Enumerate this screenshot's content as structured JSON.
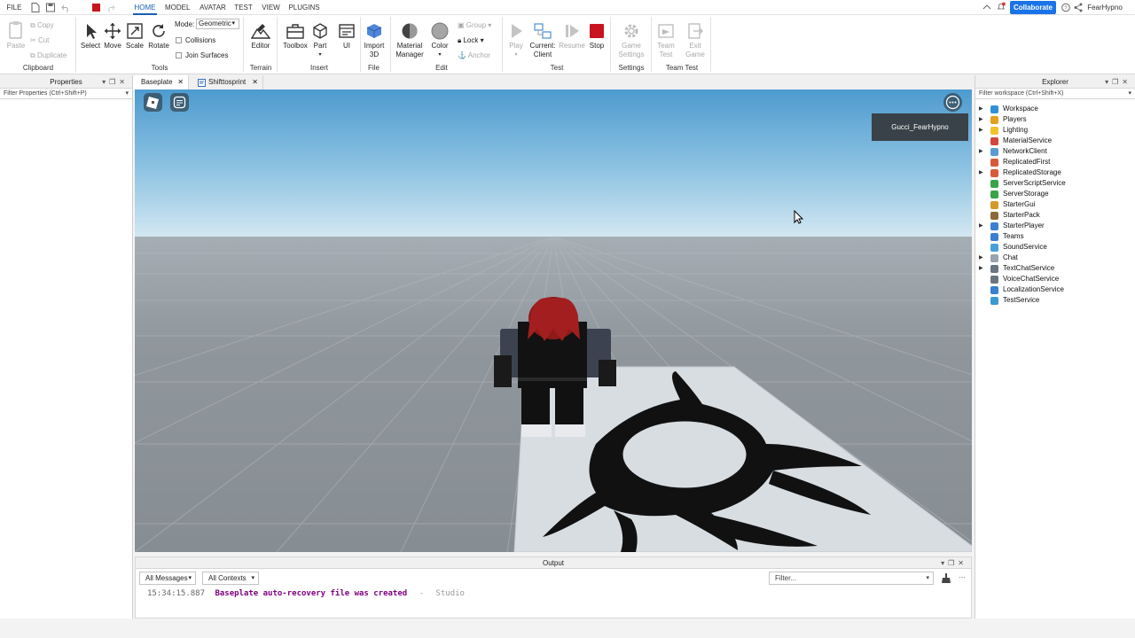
{
  "menubar": {
    "file": "FILE",
    "tabs": [
      "HOME",
      "MODEL",
      "AVATAR",
      "TEST",
      "VIEW",
      "PLUGINS"
    ],
    "collaborate": "Collaborate",
    "username": "FearHypno"
  },
  "ribbon": {
    "clipboard": {
      "paste": "Paste",
      "copy": "Copy",
      "cut": "Cut",
      "duplicate": "Duplicate",
      "group": "Clipboard"
    },
    "tools": {
      "select": "Select",
      "move": "Move",
      "scale": "Scale",
      "rotate": "Rotate",
      "mode_label": "Mode:",
      "mode_value": "Geometric",
      "collisions": "Collisions",
      "join_surfaces": "Join Surfaces",
      "group": "Tools"
    },
    "terrain": {
      "editor": "Editor",
      "group": "Terrain"
    },
    "insert": {
      "toolbox": "Toolbox",
      "part": "Part",
      "ui": "UI",
      "group": "Insert"
    },
    "file": {
      "import_line1": "Import",
      "import_line2": "3D",
      "group": "File"
    },
    "edit": {
      "material_line1": "Material",
      "material_line2": "Manager",
      "color": "Color",
      "group_btn": "Group",
      "lock": "Lock",
      "anchor": "Anchor",
      "group": "Edit"
    },
    "test": {
      "play": "Play",
      "current_line1": "Current:",
      "current_line2": "Client",
      "resume": "Resume",
      "stop": "Stop",
      "group": "Test"
    },
    "settings": {
      "game_line1": "Game",
      "game_line2": "Settings",
      "group": "Settings"
    },
    "teamtest": {
      "team_line1": "Team",
      "team_line2": "Test",
      "exit_line1": "Exit",
      "exit_line2": "Game",
      "group": "Team Test"
    }
  },
  "properties": {
    "title": "Properties",
    "filter": "Filter Properties (Ctrl+Shift+P)"
  },
  "doc_tabs": [
    "Baseplate",
    "Shifttosprint"
  ],
  "viewport": {
    "player_tag": "Gucci_FearHypno"
  },
  "output": {
    "title": "Output",
    "messages_filter": "All Messages",
    "contexts_filter": "All Contexts",
    "filter_placeholder": "Filter...",
    "log": {
      "time": "15:34:15.887",
      "message": "Baseplate auto-recovery file was created",
      "separator": "-",
      "source": "Studio"
    }
  },
  "explorer": {
    "title": "Explorer",
    "filter": "Filter workspace (Ctrl+Shift+X)",
    "items": [
      {
        "name": "Workspace",
        "expandable": true,
        "icon_color": "#2f8fd6"
      },
      {
        "name": "Players",
        "expandable": true,
        "icon_color": "#e0a020"
      },
      {
        "name": "Lighting",
        "expandable": true,
        "icon_color": "#f2c12e"
      },
      {
        "name": "MaterialService",
        "expandable": false,
        "icon_color": "#d0463a"
      },
      {
        "name": "NetworkClient",
        "expandable": true,
        "icon_color": "#5b9bd5"
      },
      {
        "name": "ReplicatedFirst",
        "expandable": false,
        "icon_color": "#d75a3a"
      },
      {
        "name": "ReplicatedStorage",
        "expandable": true,
        "icon_color": "#d75a3a"
      },
      {
        "name": "ServerScriptService",
        "expandable": false,
        "icon_color": "#3aa34a"
      },
      {
        "name": "ServerStorage",
        "expandable": false,
        "icon_color": "#3aa34a"
      },
      {
        "name": "StarterGui",
        "expandable": false,
        "icon_color": "#d39a2a"
      },
      {
        "name": "StarterPack",
        "expandable": false,
        "icon_color": "#8b6a3a"
      },
      {
        "name": "StarterPlayer",
        "expandable": true,
        "icon_color": "#3a7fd0"
      },
      {
        "name": "Teams",
        "expandable": false,
        "icon_color": "#3a7fd0"
      },
      {
        "name": "SoundService",
        "expandable": false,
        "icon_color": "#4aa0d8"
      },
      {
        "name": "Chat",
        "expandable": true,
        "icon_color": "#9aa4ae"
      },
      {
        "name": "TextChatService",
        "expandable": true,
        "icon_color": "#6a7580"
      },
      {
        "name": "VoiceChatService",
        "expandable": false,
        "icon_color": "#6a7580"
      },
      {
        "name": "LocalizationService",
        "expandable": false,
        "icon_color": "#3a7fd0"
      },
      {
        "name": "TestService",
        "expandable": false,
        "icon_color": "#3a9ad0"
      }
    ]
  },
  "colors": {
    "accent": "#1a73e8",
    "stop": "#c8141e",
    "log_message": "#800080",
    "player_tag_bg": "#394249"
  },
  "icons": [
    "new-file-icon",
    "save-icon",
    "stop-icon",
    "undo-icon",
    "redo-icon",
    "help-icon",
    "bell-icon",
    "share-icon",
    "search-icon",
    "clear-output-icon"
  ]
}
